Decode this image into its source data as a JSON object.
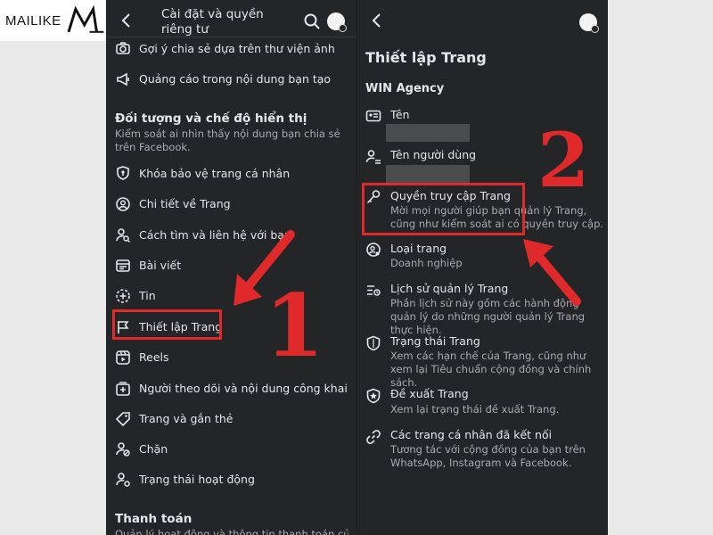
{
  "logo": {
    "text": "MAILIKE"
  },
  "left": {
    "header_title": "Cài đặt và quyền riêng tư",
    "top_items": [
      {
        "label": "Gợi ý chia sẻ dựa trên thư viện ảnh",
        "icon": "camera-icon"
      },
      {
        "label": "Quảng cáo trong nội dung bạn tạo",
        "icon": "megaphone-icon"
      }
    ],
    "section1_title": "Đối tượng và chế độ hiển thị",
    "section1_desc": "Kiểm soát ai nhìn thấy nội dung bạn chia sẻ trên Facebook.",
    "items": [
      {
        "label": "Khóa bảo vệ trang cá nhân",
        "icon": "shield-icon"
      },
      {
        "label": "Chi tiết về Trang",
        "icon": "profile-circle-icon"
      },
      {
        "label": "Cách tìm và liên hệ với bạn",
        "icon": "person-search-icon"
      },
      {
        "label": "Bài viết",
        "icon": "post-icon"
      },
      {
        "label": "Tin",
        "icon": "story-plus-icon"
      },
      {
        "label": "Thiết lập Trang",
        "icon": "flag-icon"
      },
      {
        "label": "Reels",
        "icon": "reels-icon"
      },
      {
        "label": "Người theo dõi và nội dung công khai",
        "icon": "public-plus-icon"
      },
      {
        "label": "Trang và gắn thẻ",
        "icon": "tag-icon"
      },
      {
        "label": "Chặn",
        "icon": "block-user-icon"
      },
      {
        "label": "Trạng thái hoạt động",
        "icon": "active-status-icon"
      }
    ],
    "section2_title": "Thanh toán",
    "section2_desc": "Quản lý hoạt động và thông tin thanh toán của"
  },
  "right": {
    "title": "Thiết lập Trang",
    "subtitle": "WIN Agency",
    "items": [
      {
        "label": "Tên",
        "desc": "",
        "icon": "id-card-icon"
      },
      {
        "label": "Tên người dùng",
        "desc": "",
        "icon": "person-lines-icon"
      },
      {
        "label": "Quyền truy cập Trang",
        "desc": "Mời mọi người giúp bạn quản lý Trang, cũng như kiểm soát ai có quyền truy cập.",
        "icon": "key-icon"
      },
      {
        "label": "Loại trang",
        "desc": "Doanh nghiệp",
        "icon": "page-type-icon"
      },
      {
        "label": "Lịch sử quản lý Trang",
        "desc": "Phần lịch sử này gồm các hành động quản lý do những người quản lý Trang thực hiện.",
        "icon": "history-icon"
      },
      {
        "label": "Trạng thái Trang",
        "desc": "Xem các hạn chế của Trang, cũng như xem lại Tiêu chuẩn cộng đồng và chính sách.",
        "icon": "shield-outline-icon"
      },
      {
        "label": "Đề xuất Trang",
        "desc": "Xem lại trạng thái đề xuất Trang.",
        "icon": "star-badge-icon"
      },
      {
        "label": "Các trang cá nhân đã kết nối",
        "desc": "Tương tác với cộng đồng của bạn trên WhatsApp, Instagram và Facebook.",
        "icon": "link-icon"
      }
    ]
  },
  "annotations": {
    "step1": "1",
    "step2": "2"
  },
  "colors": {
    "panel_bg": "#242526",
    "accent_red": "#e0292b",
    "text": "#e4e6eb",
    "muted": "#a8abaf"
  }
}
